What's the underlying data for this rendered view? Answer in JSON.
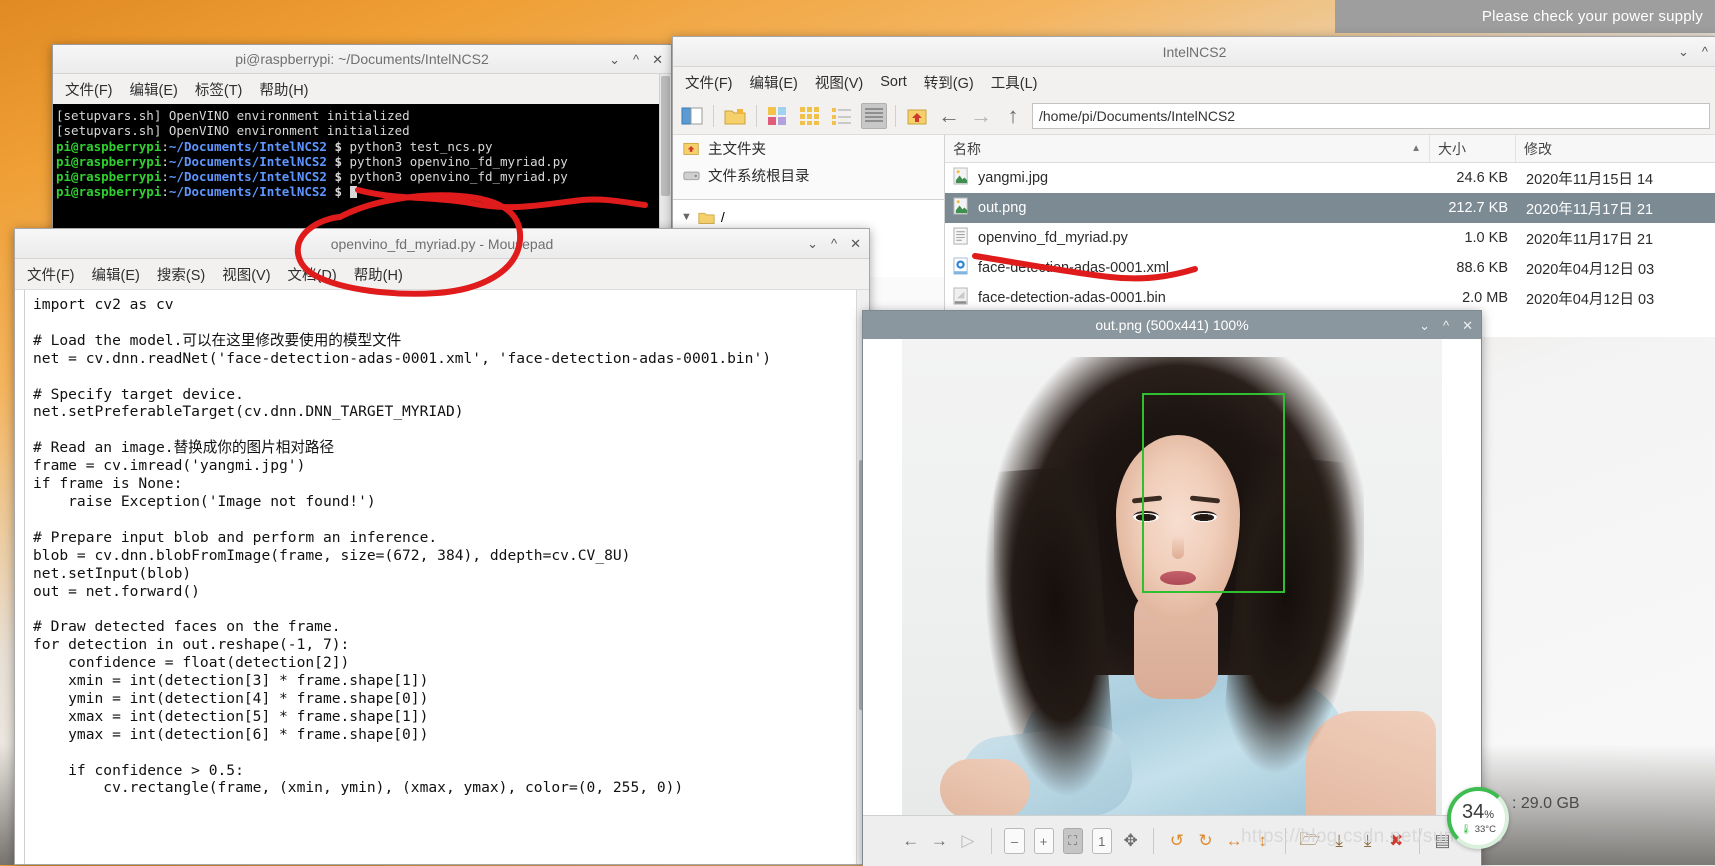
{
  "desktop": {
    "power_notice": "Please check your power supply"
  },
  "terminal": {
    "title": "pi@raspberrypi: ~/Documents/IntelNCS2",
    "menu": [
      "文件(F)",
      "编辑(E)",
      "标签(T)",
      "帮助(H)"
    ],
    "window_buttons": [
      "⌄",
      "^",
      "✕"
    ],
    "lines": [
      {
        "type": "plain",
        "text": "[setupvars.sh] OpenVINO environment initialized"
      },
      {
        "type": "plain",
        "text": "[setupvars.sh] OpenVINO environment initialized"
      },
      {
        "type": "prompt",
        "user": "pi@raspberrypi",
        "sep": ":",
        "path": "~/Documents/IntelNCS2",
        "dollar": " $ ",
        "cmd": "python3 test_ncs.py"
      },
      {
        "type": "prompt",
        "user": "pi@raspberrypi",
        "sep": ":",
        "path": "~/Documents/IntelNCS2",
        "dollar": " $ ",
        "cmd": "python3 openvino_fd_myriad.py"
      },
      {
        "type": "prompt",
        "user": "pi@raspberrypi",
        "sep": ":",
        "path": "~/Documents/IntelNCS2",
        "dollar": " $ ",
        "cmd": "python3 openvino_fd_myriad.py"
      },
      {
        "type": "prompt",
        "user": "pi@raspberrypi",
        "sep": ":",
        "path": "~/Documents/IntelNCS2",
        "dollar": " $ ",
        "cmd": ""
      }
    ]
  },
  "filemanager": {
    "title": "IntelNCS2",
    "menu": [
      "文件(F)",
      "编辑(E)",
      "视图(V)",
      "Sort",
      "转到(G)",
      "工具(L)"
    ],
    "window_buttons": [
      "⌄",
      "^"
    ],
    "path": "/home/pi/Documents/IntelNCS2",
    "sidebar": [
      {
        "label": "主文件夹",
        "icon": "home-folder-icon"
      },
      {
        "label": "文件系统根目录",
        "icon": "drive-icon"
      }
    ],
    "tree": [
      {
        "label": "/",
        "icon": "folder-icon"
      }
    ],
    "columns": {
      "name": "名称",
      "size": "大小",
      "modified": "修改",
      "sort_arrow": "▲"
    },
    "files": [
      {
        "name": "yangmi.jpg",
        "size": "24.6 KB",
        "modified": "2020年11月15日 14",
        "icon": "image-file-icon",
        "selected": false
      },
      {
        "name": "out.png",
        "size": "212.7 KB",
        "modified": "2020年11月17日 21",
        "icon": "image-file-icon",
        "selected": true
      },
      {
        "name": "openvino_fd_myriad.py",
        "size": "1.0 KB",
        "modified": "2020年11月17日 21",
        "icon": "text-file-icon",
        "selected": false
      },
      {
        "name": "face-detection-adas-0001.xml",
        "size": "88.6 KB",
        "modified": "2020年04月12日 03",
        "icon": "xml-file-icon",
        "selected": false
      },
      {
        "name": "face-detection-adas-0001.bin",
        "size": "2.0 MB",
        "modified": "2020年04月12日 03",
        "icon": "binary-file-icon",
        "selected": false
      }
    ]
  },
  "mousepad": {
    "title": "openvino_fd_myriad.py - Mousepad",
    "menu": [
      "文件(F)",
      "编辑(E)",
      "搜索(S)",
      "视图(V)",
      "文档(D)",
      "帮助(H)"
    ],
    "window_buttons": [
      "⌄",
      "^",
      "✕"
    ],
    "code": "import cv2 as cv\n\n# Load the model.可以在这里修改要使用的模型文件\nnet = cv.dnn.readNet('face-detection-adas-0001.xml', 'face-detection-adas-0001.bin')\n\n# Specify target device.\nnet.setPreferableTarget(cv.dnn.DNN_TARGET_MYRIAD)\n\n# Read an image.替换成你的图片相对路径\nframe = cv.imread('yangmi.jpg')\nif frame is None:\n    raise Exception('Image not found!')\n\n# Prepare input blob and perform an inference.\nblob = cv.dnn.blobFromImage(frame, size=(672, 384), ddepth=cv.CV_8U)\nnet.setInput(blob)\nout = net.forward()\n\n# Draw detected faces on the frame.\nfor detection in out.reshape(-1, 7):\n    confidence = float(detection[2])\n    xmin = int(detection[3] * frame.shape[1])\n    ymin = int(detection[4] * frame.shape[0])\n    xmax = int(detection[5] * frame.shape[1])\n    ymax = int(detection[6] * frame.shape[0])\n\n    if confidence > 0.5:\n        cv.rectangle(frame, (xmin, ymin), (xmax, ymax), color=(0, 255, 0))"
  },
  "viewer": {
    "title": "out.png (500x441) 100%",
    "window_buttons": [
      "⌄",
      "^",
      "✕"
    ],
    "toolbar": [
      {
        "name": "previous-image-button",
        "glyph": "←"
      },
      {
        "name": "next-image-button",
        "glyph": "→"
      },
      {
        "name": "slideshow-button",
        "glyph": "▷"
      },
      {
        "name": "zoom-out-button",
        "glyph": "–"
      },
      {
        "name": "zoom-in-button",
        "glyph": "+"
      },
      {
        "name": "fit-window-button",
        "glyph": "⛶"
      },
      {
        "name": "original-size-button",
        "glyph": "1"
      },
      {
        "name": "full-screen-button",
        "glyph": "✥"
      },
      {
        "name": "rotate-left-button",
        "glyph": "↺"
      },
      {
        "name": "rotate-right-button",
        "glyph": "↻"
      },
      {
        "name": "flip-horizontal-button",
        "glyph": "↔"
      },
      {
        "name": "flip-vertical-button",
        "glyph": "↕"
      },
      {
        "name": "open-file-button",
        "glyph": "🗁"
      },
      {
        "name": "save-file-button",
        "glyph": "⤓"
      },
      {
        "name": "save-as-button",
        "glyph": "⤓"
      },
      {
        "name": "delete-file-button",
        "glyph": "✖"
      },
      {
        "name": "preferences-button",
        "glyph": "▤"
      },
      {
        "name": "quit-button",
        "glyph": "⏻"
      }
    ]
  },
  "system_monitor": {
    "cpu_percent": "34",
    "percent_symbol": "%",
    "temperature": "33°C",
    "memory": ": 29.0 GB",
    "watermark": "https://blog.csdn.net/sundm75"
  }
}
